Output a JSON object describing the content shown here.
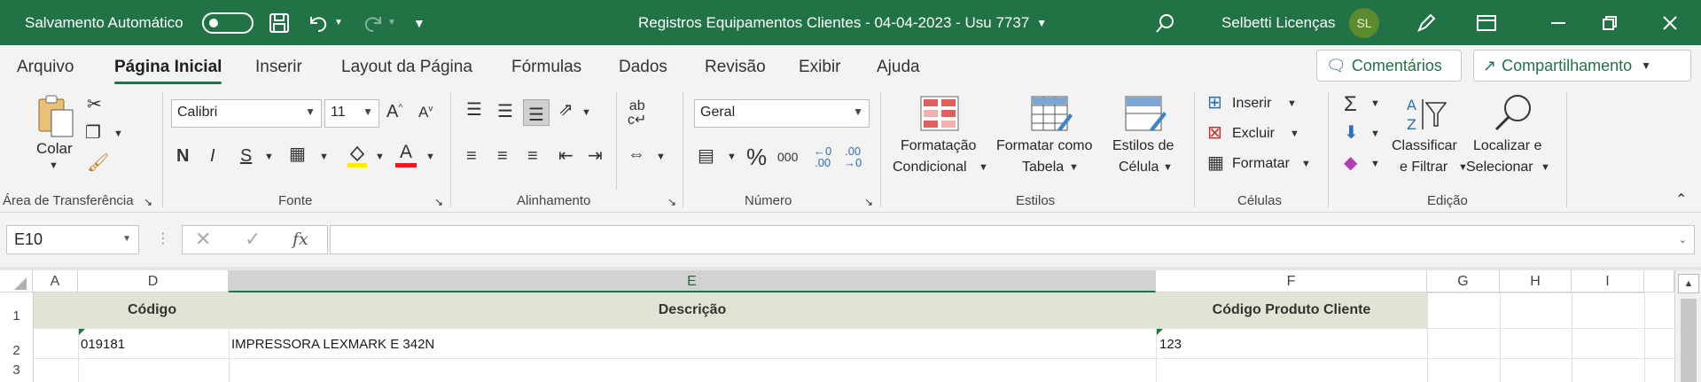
{
  "titlebar": {
    "autosave_label": "Salvamento Automático",
    "doc_title": "Registros Equipamentos Clientes - 04-04-2023 - Usu 7737",
    "user_name": "Selbetti Licenças",
    "user_initials": "SL"
  },
  "menu": {
    "tabs": [
      "Arquivo",
      "Página Inicial",
      "Inserir",
      "Layout da Página",
      "Fórmulas",
      "Dados",
      "Revisão",
      "Exibir",
      "Ajuda"
    ],
    "active_tab": "Página Inicial",
    "comments_label": "Comentários",
    "share_label": "Compartilhamento"
  },
  "ribbon": {
    "clipboard": {
      "paste_label": "Colar",
      "group_label": "Área de Transferência"
    },
    "font": {
      "font_name": "Calibri",
      "font_size": "11",
      "bold": "N",
      "italic": "I",
      "underline": "S",
      "group_label": "Fonte"
    },
    "alignment": {
      "group_label": "Alinhamento"
    },
    "number": {
      "format": "Geral",
      "percent": "%",
      "thousands": "000",
      "group_label": "Número"
    },
    "styles": {
      "conditional_l1": "Formatação",
      "conditional_l2": "Condicional",
      "table_l1": "Formatar como",
      "table_l2": "Tabela",
      "cell_l1": "Estilos de",
      "cell_l2": "Célula",
      "group_label": "Estilos"
    },
    "cells": {
      "insert": "Inserir",
      "delete": "Excluir",
      "format": "Formatar",
      "group_label": "Células"
    },
    "editing": {
      "sort_l1": "Classificar",
      "sort_l2": "e Filtrar",
      "find_l1": "Localizar e",
      "find_l2": "Selecionar",
      "group_label": "Edição"
    }
  },
  "formula_bar": {
    "name_box": "E10",
    "fx": "fx",
    "content": ""
  },
  "sheet": {
    "columns": [
      "A",
      "D",
      "E",
      "F",
      "G",
      "H",
      "I"
    ],
    "rows": [
      "1",
      "2",
      "3"
    ],
    "header_row": {
      "codigo": "Código",
      "descricao": "Descrição",
      "codigo_cliente": "Código Produto Cliente"
    },
    "row2": {
      "codigo": "019181",
      "descricao": "IMPRESSORA LEXMARK E 342N",
      "codigo_cliente": "123"
    }
  },
  "colors": {
    "accent": "#217346",
    "header_fill": "#e1e4d5"
  }
}
